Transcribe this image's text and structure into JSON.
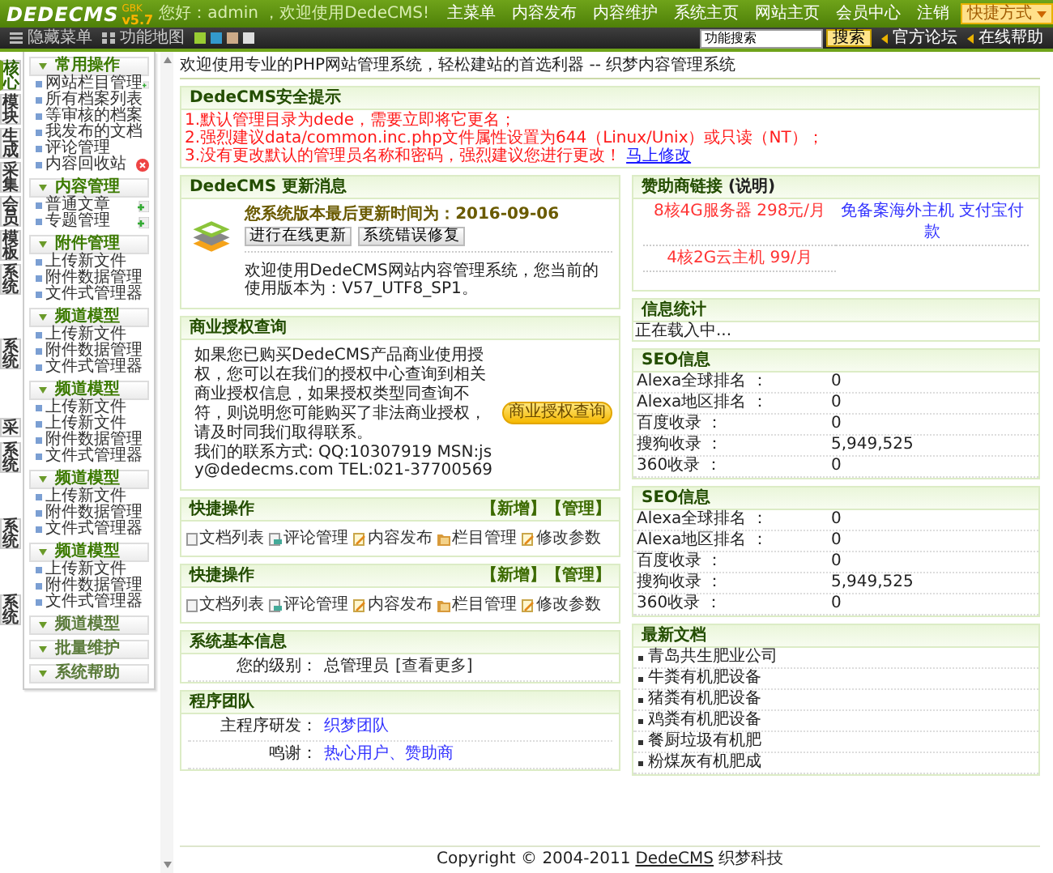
{
  "header": {
    "logo": "DEDECMS",
    "version": "v5.7",
    "edition": "GBK",
    "greeting": "您好：admin ，欢迎使用DedeCMS!",
    "nav": [
      "主菜单",
      "内容发布",
      "内容维护",
      "系统主页",
      "网站主页",
      "会员中心",
      "注销"
    ],
    "shortcut": "快捷方式"
  },
  "toolbar": {
    "hide_menu": "隐藏菜单",
    "map": "功能地图",
    "search_value": "功能搜索",
    "search_button": "搜索",
    "links": [
      "官方论坛",
      "在线帮助"
    ]
  },
  "side_tabs": [
    {
      "label": "核心",
      "selected": true
    },
    {
      "label": "模块",
      "selected": false
    },
    {
      "label": "生成",
      "selected": false
    },
    {
      "label": "采集",
      "selected": false
    },
    {
      "label": "会员",
      "selected": false
    },
    {
      "label": "模板",
      "selected": false
    },
    {
      "label": "系统",
      "selected": false
    },
    {
      "label": "系统",
      "selected": false
    },
    {
      "label": "采",
      "selected": false
    },
    {
      "label": "系统",
      "selected": false
    },
    {
      "label": "系统",
      "selected": false
    },
    {
      "label": "系统",
      "selected": false
    }
  ],
  "menu": [
    {
      "title": "常用操作",
      "expanded": true,
      "items": [
        {
          "label": "网站栏目管理",
          "kind": "add"
        },
        {
          "label": "所有档案列表",
          "kind": "plain"
        },
        {
          "label": "等审核的档案",
          "kind": "plain"
        },
        {
          "label": "我发布的文档",
          "kind": "plain"
        },
        {
          "label": "评论管理",
          "kind": "plain"
        },
        {
          "label": "内容回收站",
          "kind": "trash"
        }
      ]
    },
    {
      "title": "内容管理",
      "expanded": true,
      "items": [
        {
          "label": "普通文章",
          "kind": "add"
        },
        {
          "label": "专题管理",
          "kind": "add"
        }
      ]
    },
    {
      "title": "附件管理",
      "expanded": true,
      "items": [
        {
          "label": "上传新文件",
          "kind": "plain"
        },
        {
          "label": "附件数据管理",
          "kind": "plain"
        },
        {
          "label": "文件式管理器",
          "kind": "plain"
        }
      ]
    },
    {
      "title": "频道模型",
      "expanded": true,
      "items": [
        {
          "label": "上传新文件",
          "kind": "plain"
        },
        {
          "label": "附件数据管理",
          "kind": "plain"
        },
        {
          "label": "文件式管理器",
          "kind": "plain"
        }
      ]
    },
    {
      "title": "频道模型",
      "expanded": true,
      "items": [
        {
          "label": "上传新文件",
          "kind": "plain"
        },
        {
          "label": "上传新文件",
          "kind": "plain"
        },
        {
          "label": "附件数据管理",
          "kind": "plain"
        },
        {
          "label": "文件式管理器",
          "kind": "plain"
        }
      ]
    },
    {
      "title": "频道模型",
      "expanded": true,
      "items": [
        {
          "label": "上传新文件",
          "kind": "plain"
        },
        {
          "label": "附件数据管理",
          "kind": "plain"
        },
        {
          "label": "文件式管理器",
          "kind": "plain"
        }
      ]
    },
    {
      "title": "频道模型",
      "expanded": true,
      "items": [
        {
          "label": "上传新文件",
          "kind": "plain"
        },
        {
          "label": "附件数据管理",
          "kind": "plain"
        },
        {
          "label": "文件式管理器",
          "kind": "plain"
        }
      ]
    },
    {
      "title": "频道模型",
      "expanded": false
    },
    {
      "title": "批量维护",
      "expanded": false
    },
    {
      "title": "系统帮助",
      "expanded": false
    }
  ],
  "welcome": "欢迎使用专业的PHP网站管理系统，轻松建站的首选利器 -- 织梦内容管理系统",
  "security": {
    "title": "DedeCMS安全提示",
    "lines": [
      {
        "text": "1.默认管理目录为dede，需要立即将它更名；"
      },
      {
        "text": "2.强烈建议data/common.inc.php文件属性设置为644（Linux/Unix）或只读（NT）；"
      },
      {
        "text": "3.没有更改默认的管理员名称和密码，强烈建议您进行更改！",
        "link": "马上修改"
      }
    ]
  },
  "update": {
    "title": "DedeCMS 更新消息",
    "headline": "您系统版本最后更新时间为：2016-09-06",
    "buttons": [
      "进行在线更新",
      "系统错误修复"
    ],
    "message": "欢迎使用DedeCMS网站内容管理系统，您当前的使用版本为：V57_UTF8_SP1。"
  },
  "license": {
    "title": "商业授权查询",
    "paragraph": "如果您已购买DedeCMS产品商业使用授权，您可以在我们的授权中心查询到相关商业授权信息，如果授权类型同查询不符，则说明您可能购买了非法商业授权，请及时同我们取得联系。",
    "contact": "我们的联系方式: QQ:10307919 MSN:jsy@dedecms.com TEL:021-37700569",
    "button": "商业授权查询"
  },
  "quick": [
    {
      "title": "快捷操作",
      "actions": [
        "【新增】",
        "【管理】"
      ],
      "items": [
        {
          "label": "文档列表",
          "kind": "list"
        },
        {
          "label": "评论管理",
          "kind": "comment"
        },
        {
          "label": "内容发布",
          "kind": "edit"
        },
        {
          "label": "栏目管理",
          "kind": "folder"
        },
        {
          "label": "修改参数",
          "kind": "edit"
        }
      ]
    },
    {
      "title": "快捷操作",
      "actions": [
        "【新增】",
        "【管理】"
      ],
      "items": [
        {
          "label": "文档列表",
          "kind": "list"
        },
        {
          "label": "评论管理",
          "kind": "comment"
        },
        {
          "label": "内容发布",
          "kind": "edit"
        },
        {
          "label": "栏目管理",
          "kind": "folder"
        },
        {
          "label": "修改参数",
          "kind": "edit"
        }
      ]
    }
  ],
  "sysinfo": {
    "title": "系统基本信息",
    "label": "您的级别：",
    "value": "总管理员",
    "link": "[查看更多]"
  },
  "team": {
    "title": "程序团队",
    "rows": [
      {
        "label": "主程序研发：",
        "link": "织梦团队"
      },
      {
        "label": "鸣谢：",
        "link": "热心用户、赞助商"
      }
    ]
  },
  "sponsor": {
    "title": "赞助商链接",
    "note": "(说明)",
    "links": [
      {
        "text": "8核4G服务器 298元/月",
        "color": "#ff3333"
      },
      {
        "text": "免备案海外主机 支付宝付款",
        "color": "#3333ff"
      },
      {
        "text": "4核2G云主机 99/月",
        "color": "#ff3333"
      }
    ]
  },
  "stats": {
    "title": "信息统计",
    "text": "正在载入中..."
  },
  "seo": [
    {
      "title": "SEO信息",
      "rows": [
        {
          "label": "Alexa全球排名 ：",
          "value": "0"
        },
        {
          "label": "Alexa地区排名 ：",
          "value": "0"
        },
        {
          "label": "百度收录 ：",
          "value": "0"
        },
        {
          "label": "搜狗收录 ：",
          "value": "5,949,525"
        },
        {
          "label": "360收录 ：",
          "value": "0"
        }
      ]
    },
    {
      "title": "SEO信息",
      "rows": [
        {
          "label": "Alexa全球排名 ：",
          "value": "0"
        },
        {
          "label": "Alexa地区排名 ：",
          "value": "0"
        },
        {
          "label": "百度收录 ：",
          "value": "0"
        },
        {
          "label": "搜狗收录 ：",
          "value": "5,949,525"
        },
        {
          "label": "360收录 ：",
          "value": "0"
        }
      ]
    }
  ],
  "news": {
    "title": "最新文档",
    "items": [
      "青岛共生肥业公司",
      "牛粪有机肥设备",
      "猪粪有机肥设备",
      "鸡粪有机肥设备",
      "餐厨垃圾有机肥",
      "粉煤灰有机肥成"
    ]
  },
  "footer": {
    "copyright": "Copyright © 2004-2011",
    "brand": "DedeCMS",
    "company": "织梦科技"
  }
}
